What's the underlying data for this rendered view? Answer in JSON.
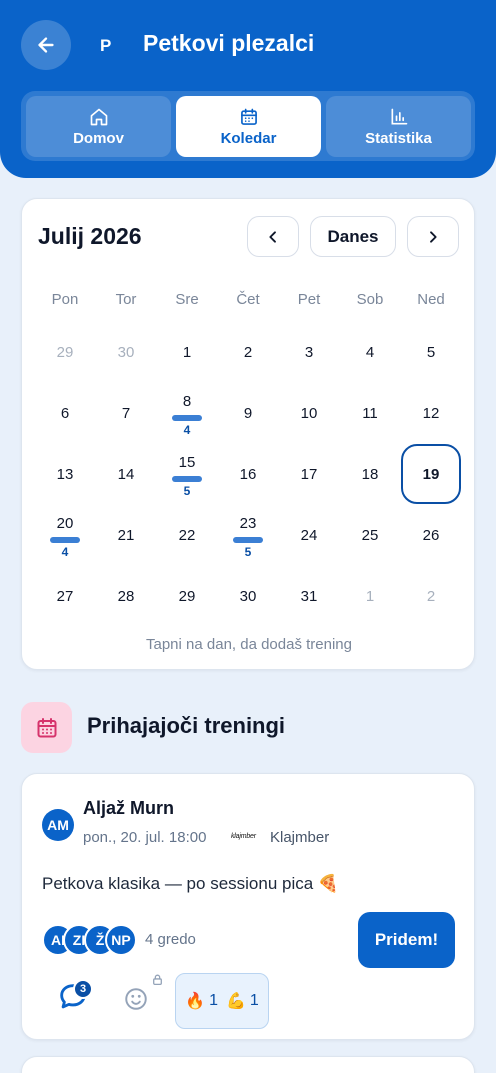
{
  "header": {
    "logo_letter": "P",
    "title": "Petkovi plezalci",
    "tabs": [
      {
        "label": "Domov",
        "icon": "home-icon",
        "active": false
      },
      {
        "label": "Koledar",
        "icon": "calendar-icon",
        "active": true
      },
      {
        "label": "Statistika",
        "icon": "bar-chart-icon",
        "active": false
      }
    ]
  },
  "calendar": {
    "month_title": "Julij 2026",
    "today_label": "Danes",
    "weekdays": [
      "Pon",
      "Tor",
      "Sre",
      "Čet",
      "Pet",
      "Sob",
      "Ned"
    ],
    "weeks": [
      [
        {
          "d": "29",
          "muted": true
        },
        {
          "d": "30",
          "muted": true
        },
        {
          "d": "1"
        },
        {
          "d": "2"
        },
        {
          "d": "3"
        },
        {
          "d": "4"
        },
        {
          "d": "5"
        }
      ],
      [
        {
          "d": "6"
        },
        {
          "d": "7"
        },
        {
          "d": "8",
          "count": "4"
        },
        {
          "d": "9"
        },
        {
          "d": "10"
        },
        {
          "d": "11"
        },
        {
          "d": "12"
        }
      ],
      [
        {
          "d": "13"
        },
        {
          "d": "14"
        },
        {
          "d": "15",
          "count": "5"
        },
        {
          "d": "16"
        },
        {
          "d": "17"
        },
        {
          "d": "18"
        },
        {
          "d": "19",
          "today": true
        }
      ],
      [
        {
          "d": "20",
          "count": "4"
        },
        {
          "d": "21"
        },
        {
          "d": "22"
        },
        {
          "d": "23",
          "count": "5"
        },
        {
          "d": "24"
        },
        {
          "d": "25"
        },
        {
          "d": "26"
        }
      ],
      [
        {
          "d": "27"
        },
        {
          "d": "28"
        },
        {
          "d": "29"
        },
        {
          "d": "30"
        },
        {
          "d": "31"
        },
        {
          "d": "1",
          "muted": true
        },
        {
          "d": "2",
          "muted": true
        }
      ]
    ],
    "hint": "Tapni na dan, da dodaš trening"
  },
  "upcoming": {
    "title": "Prihajajoči treningi",
    "event": {
      "author_initials": "AM",
      "author_name": "Aljaž Murn",
      "when": "pon., 20. jul. 18:00",
      "brand_text": "klajmber",
      "location": "Klajmber",
      "description": "Petkova klasika — po sessionu pica 🍕",
      "attendees": [
        "AI",
        "ZI",
        "Ž",
        "NP"
      ],
      "attending_text": "4 gredo",
      "join_label": "Pridem!",
      "comment_count": "3",
      "reactions": [
        {
          "emoji": "🔥",
          "count": "1"
        },
        {
          "emoji": "💪",
          "count": "1"
        }
      ]
    }
  },
  "colors": {
    "primary": "#0a63c9",
    "accent_bar": "#3b7fd4",
    "page_bg": "#e8f0fa"
  }
}
